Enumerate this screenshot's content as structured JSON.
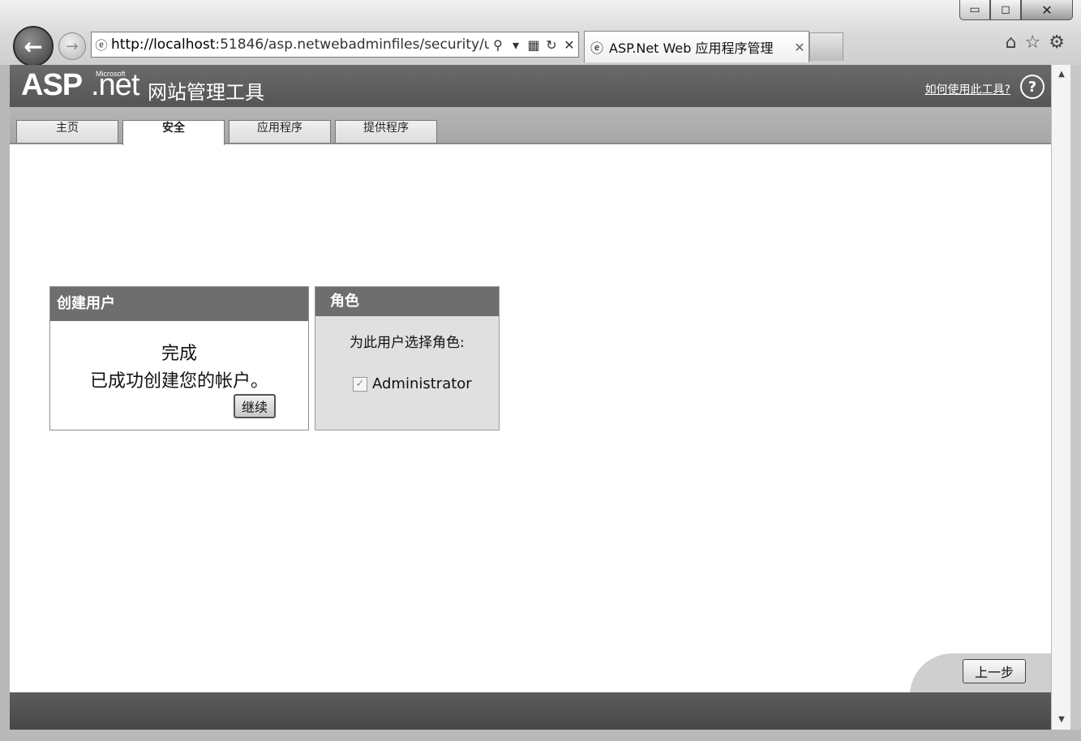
{
  "browser": {
    "window_controls": {
      "minimize": "▭",
      "maximize": "◻",
      "close": "✕"
    },
    "address_bar": {
      "url_host": "http://localhost",
      "url_rest": ":51846/asp.netwebadminfiles/security/u",
      "icon": "ie-icon"
    },
    "address_buttons": [
      "search-icon",
      "dropdown-icon",
      "compat-icon",
      "refresh-icon",
      "stop-icon"
    ],
    "active_tab": {
      "title": "ASP.Net Web 应用程序管理"
    },
    "toolbar_icons": [
      "home-icon",
      "favorites-icon",
      "settings-icon"
    ]
  },
  "header": {
    "logo_asp": "ASP",
    "logo_net": ".net",
    "logo_ms": "Microsoft",
    "title": "网站管理工具",
    "help_link": "如何使用此工具?",
    "help_icon": "?"
  },
  "nav_tabs": [
    {
      "label": "主页",
      "active": false
    },
    {
      "label": "安全",
      "active": true
    },
    {
      "label": "应用程序",
      "active": false
    },
    {
      "label": "提供程序",
      "active": false
    }
  ],
  "create_user_panel": {
    "heading": "创建用户",
    "complete_title": "完成",
    "complete_message": "已成功创建您的帐户。",
    "continue_label": "继续"
  },
  "roles_panel": {
    "heading": "角色",
    "prompt": "为此用户选择角色:",
    "roles": [
      {
        "name": "Administrator",
        "checked": true
      }
    ]
  },
  "footer": {
    "previous_label": "上一步"
  }
}
